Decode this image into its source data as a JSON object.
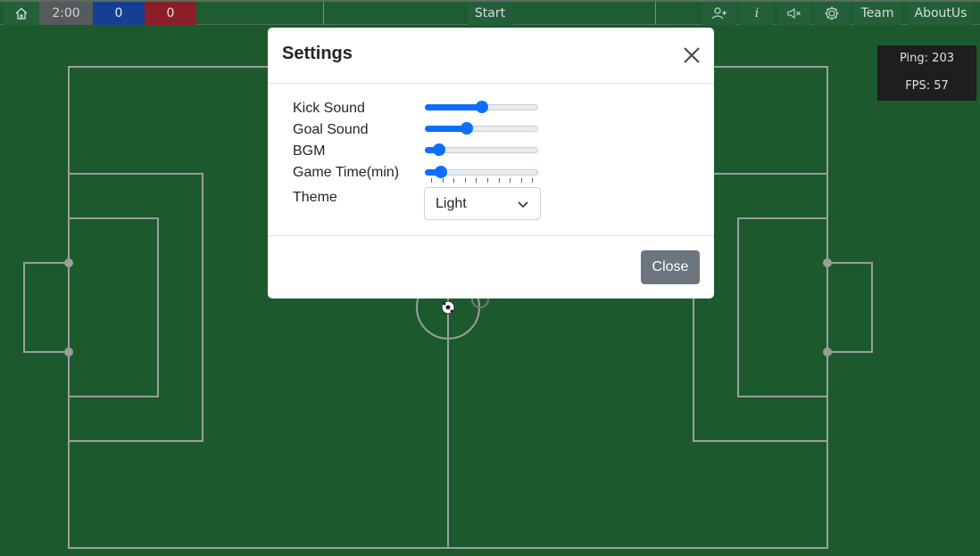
{
  "topbar": {
    "home_icon": "home-icon",
    "time": "2:00",
    "score_blue": "0",
    "score_red": "0",
    "start_label": "Start",
    "icons": [
      "add-user-icon",
      "info-icon",
      "mute-icon",
      "gear-icon"
    ],
    "info_glyph": "i",
    "team_label": "Team",
    "about_label": "AboutUs"
  },
  "stats": {
    "ping": "Ping: 203",
    "fps": "FPS: 57"
  },
  "settings": {
    "title": "Settings",
    "rows": {
      "kick_sound": {
        "label": "Kick Sound",
        "value": 0.5
      },
      "goal_sound": {
        "label": "Goal Sound",
        "value": 0.35
      },
      "bgm": {
        "label": "BGM",
        "value": 0.08
      },
      "game_time": {
        "label": "Game Time(min)",
        "value": 0.1
      }
    },
    "theme_label": "Theme",
    "theme_value": "Light",
    "close_label": "Close"
  },
  "colors": {
    "pitch": "#1c5a2e",
    "lines": "#9a9f9c",
    "accent": "#0d6efd",
    "team_blue": "#153f95",
    "team_red": "#8a1f27"
  }
}
